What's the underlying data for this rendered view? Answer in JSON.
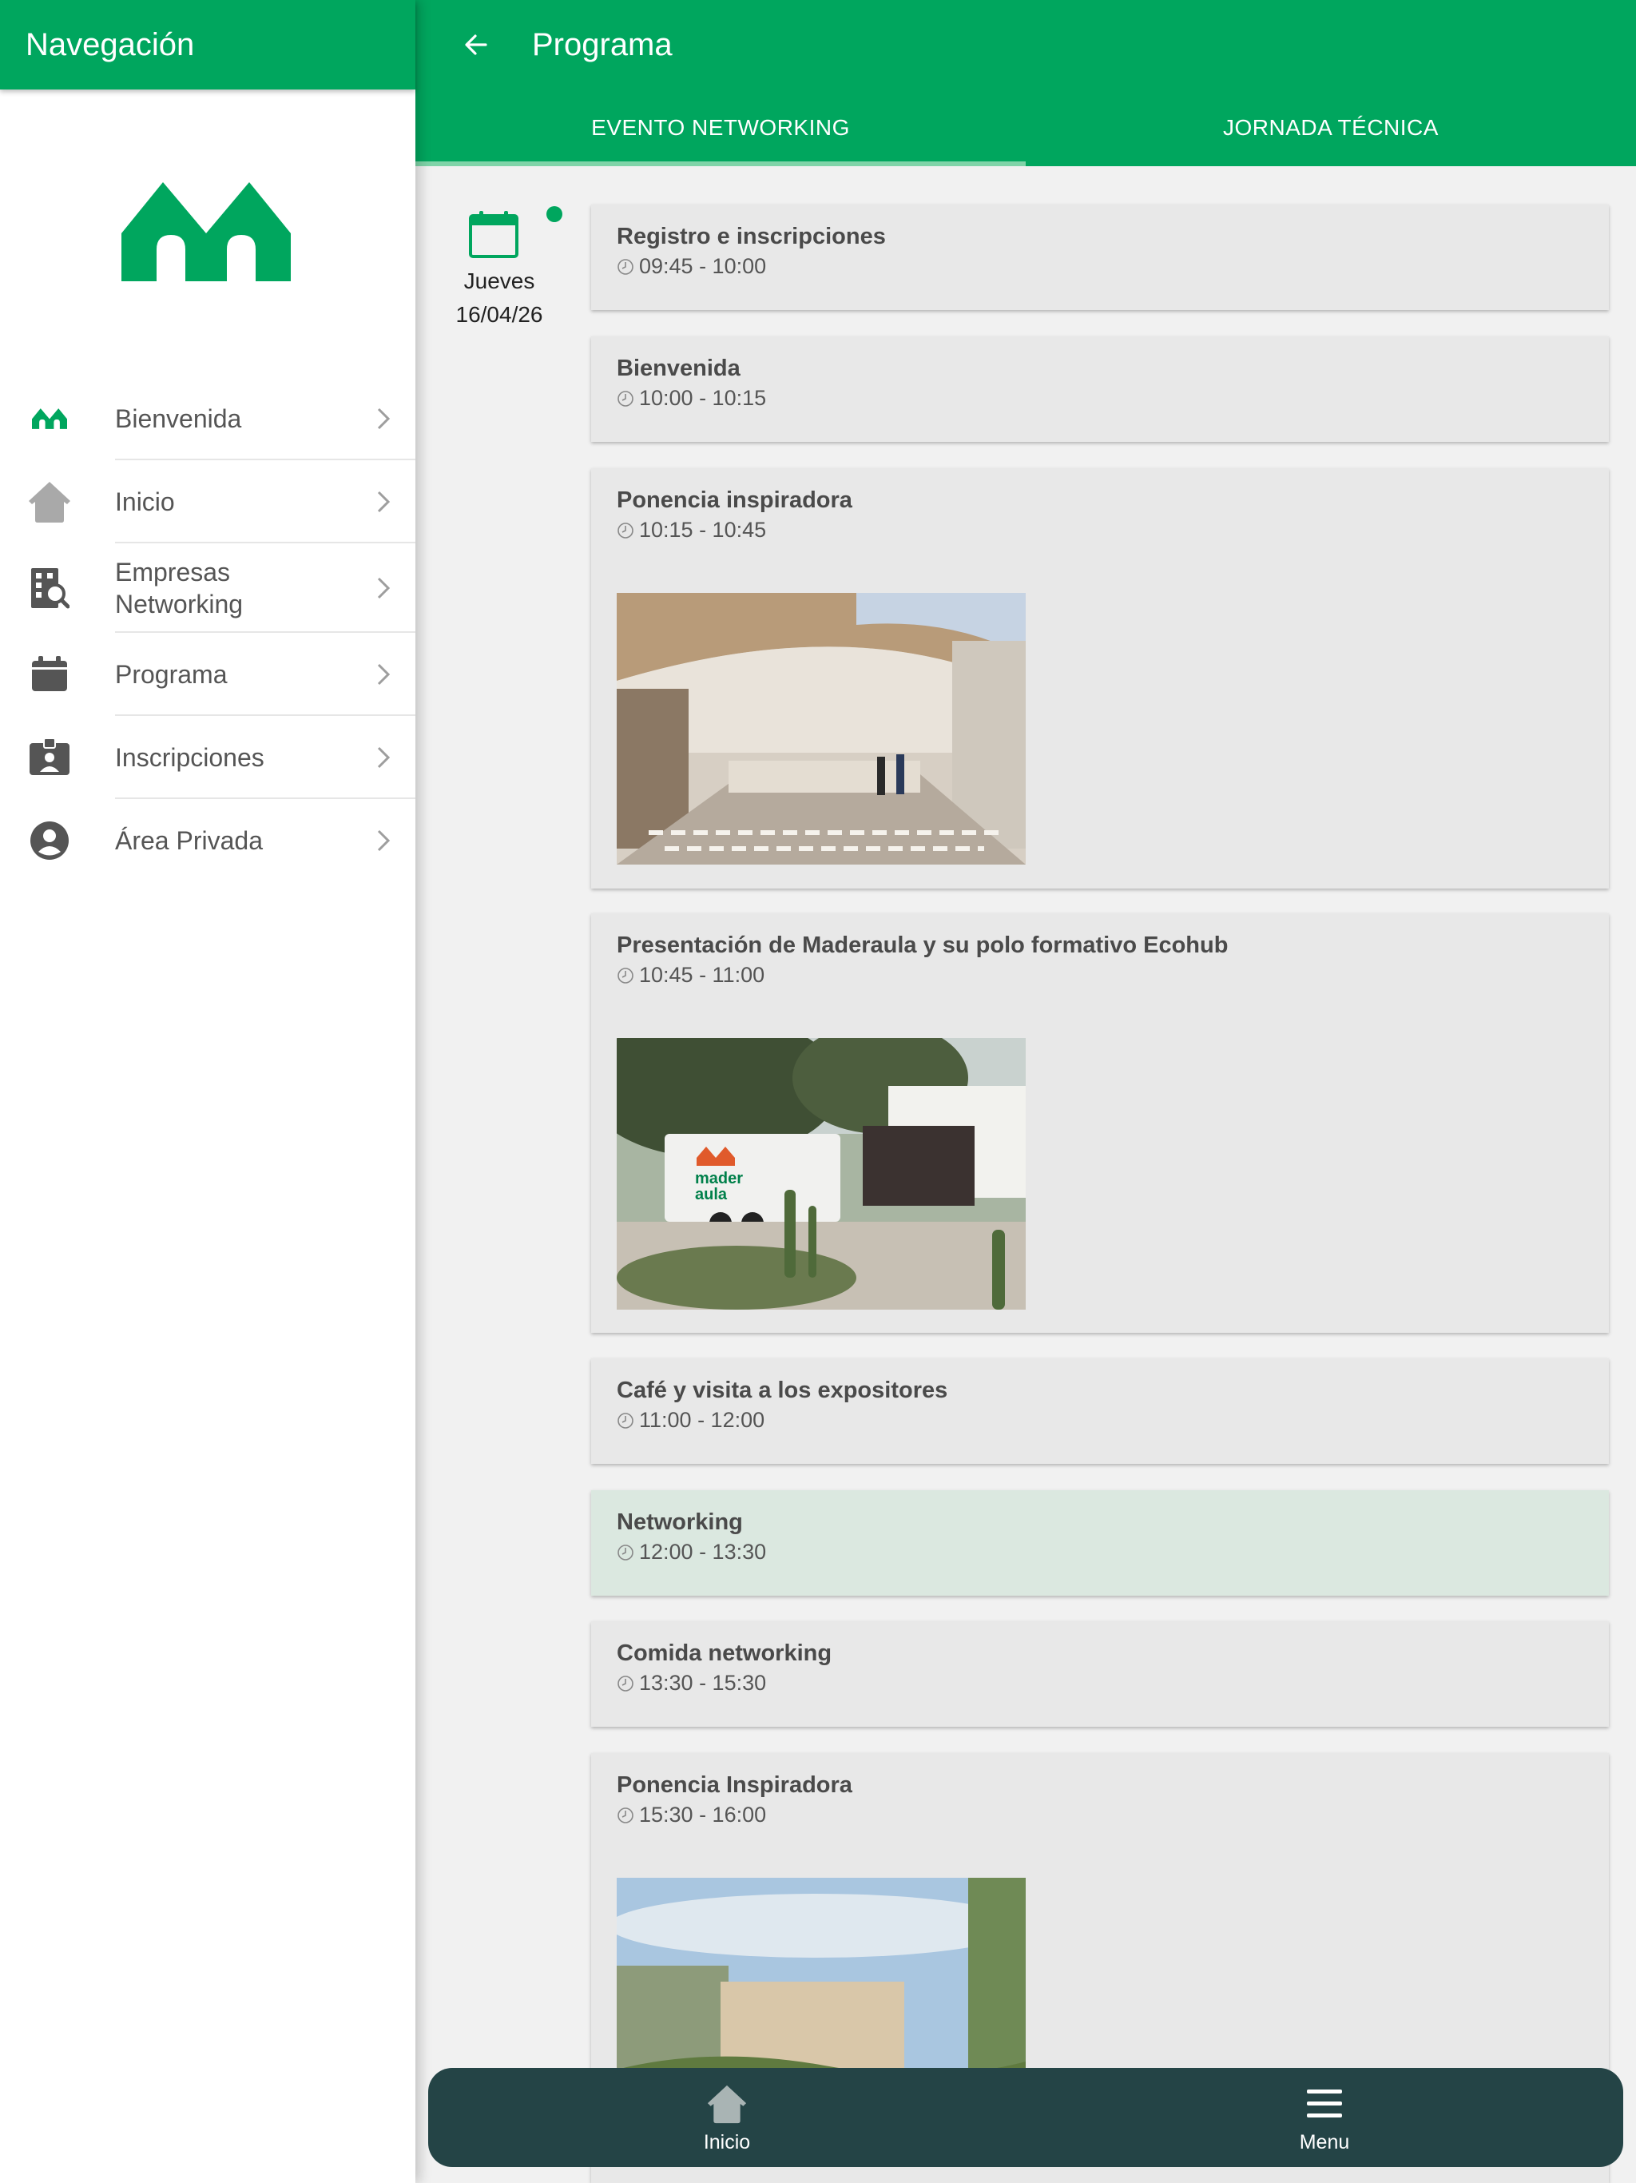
{
  "drawer": {
    "title": "Navegación",
    "items": [
      {
        "label": "Bienvenida",
        "icon": "brand-logo-icon"
      },
      {
        "label": "Inicio",
        "icon": "home-icon"
      },
      {
        "label": "Empresas Networking",
        "icon": "building-search-icon"
      },
      {
        "label": "Programa",
        "icon": "calendar-icon"
      },
      {
        "label": "Inscripciones",
        "icon": "badge-icon"
      },
      {
        "label": "Área Privada",
        "icon": "account-circle-icon"
      }
    ]
  },
  "header": {
    "title": "Programa",
    "back_icon": "arrow-left-icon"
  },
  "tabs": [
    {
      "label": "EVENTO NETWORKING",
      "active": true
    },
    {
      "label": "JORNADA TÉCNICA",
      "active": false
    }
  ],
  "date": {
    "day": "Jueves",
    "date": "16/04/26"
  },
  "sessions": [
    {
      "title": "Registro e inscripciones",
      "time": "09:45 - 10:00"
    },
    {
      "title": "Bienvenida",
      "time": "10:00 - 10:15"
    },
    {
      "title": "Ponencia inspiradora",
      "time": "10:15 - 10:45"
    },
    {
      "title": "Presentación de Maderaula y su polo formativo Ecohub",
      "time": "10:45 - 11:00",
      "img_text": {
        "line1": "mader",
        "line2": "aula"
      }
    },
    {
      "title": "Café y visita a los expositores",
      "time": "11:00 - 12:00"
    },
    {
      "title": "Networking",
      "time": "12:00 - 13:30"
    },
    {
      "title": "Comida networking",
      "time": "13:30 - 15:30"
    },
    {
      "title": "Ponencia Inspiradora",
      "time": "15:30 - 16:00"
    }
  ],
  "bottom_nav": {
    "home_label": "Inicio",
    "menu_label": "Menu"
  },
  "colors": {
    "brand_green": "#00a65e",
    "bottom_nav_bg": "#244446",
    "highlight_card": "#dbe8e0"
  }
}
